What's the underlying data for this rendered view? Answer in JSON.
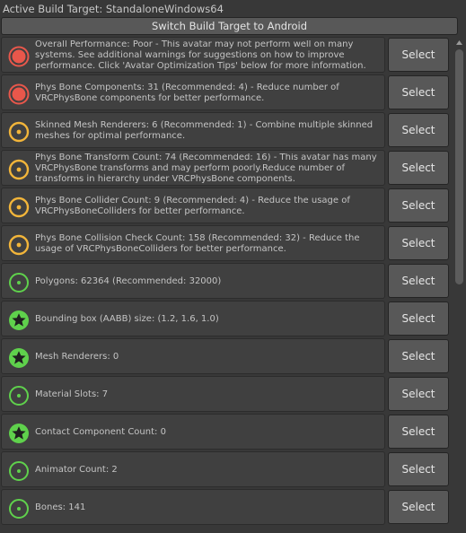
{
  "header": {
    "build_target": "Active Build Target: StandaloneWindows64",
    "switch_label": "Switch Build Target to Android"
  },
  "rows": [
    {
      "icon": "error",
      "message": "Overall Performance: Poor - This avatar may not perform well on many systems. See additional warnings for suggestions on how to improve performance. Click 'Avatar Optimization Tips' below for more information.",
      "button": "Select"
    },
    {
      "icon": "error",
      "message": "Phys Bone Components: 31 (Recommended: 4) - Reduce number of VRCPhysBone components for better performance.",
      "button": "Select"
    },
    {
      "icon": "warning",
      "message": "Skinned Mesh Renderers: 6 (Recommended: 1) - Combine multiple skinned meshes for optimal performance.",
      "button": "Select"
    },
    {
      "icon": "warning",
      "message": "Phys Bone Transform Count: 74 (Recommended: 16) - This avatar has many VRCPhysBone transforms and may perform poorly.Reduce number of transforms in hierarchy under VRCPhysBone components.",
      "button": "Select"
    },
    {
      "icon": "warning",
      "message": "Phys Bone Collider Count: 9 (Recommended: 4) - Reduce the usage of VRCPhysBoneColliders for better performance.",
      "button": "Select"
    },
    {
      "icon": "warning",
      "message": "Phys Bone Collision Check Count: 158 (Recommended: 32) - Reduce the usage of VRCPhysBoneColliders for better performance.",
      "button": "Select"
    },
    {
      "icon": "good",
      "message": "Polygons: 62364 (Recommended: 32000)",
      "button": "Select"
    },
    {
      "icon": "excellent",
      "message": "Bounding box (AABB) size: (1.2, 1.6, 1.0)",
      "button": "Select"
    },
    {
      "icon": "excellent",
      "message": "Mesh Renderers: 0",
      "button": "Select"
    },
    {
      "icon": "good",
      "message": "Material Slots: 7",
      "button": "Select"
    },
    {
      "icon": "excellent",
      "message": "Contact Component Count: 0",
      "button": "Select"
    },
    {
      "icon": "good",
      "message": "Animator Count: 2",
      "button": "Select"
    },
    {
      "icon": "good",
      "message": "Bones: 141",
      "button": "Select"
    }
  ],
  "colors": {
    "error": "#e8574b",
    "warning": "#f2b53a",
    "good": "#5fd14c",
    "excellent": "#5fd14c"
  },
  "scrollbar": {
    "visible_fraction": 0.5
  }
}
